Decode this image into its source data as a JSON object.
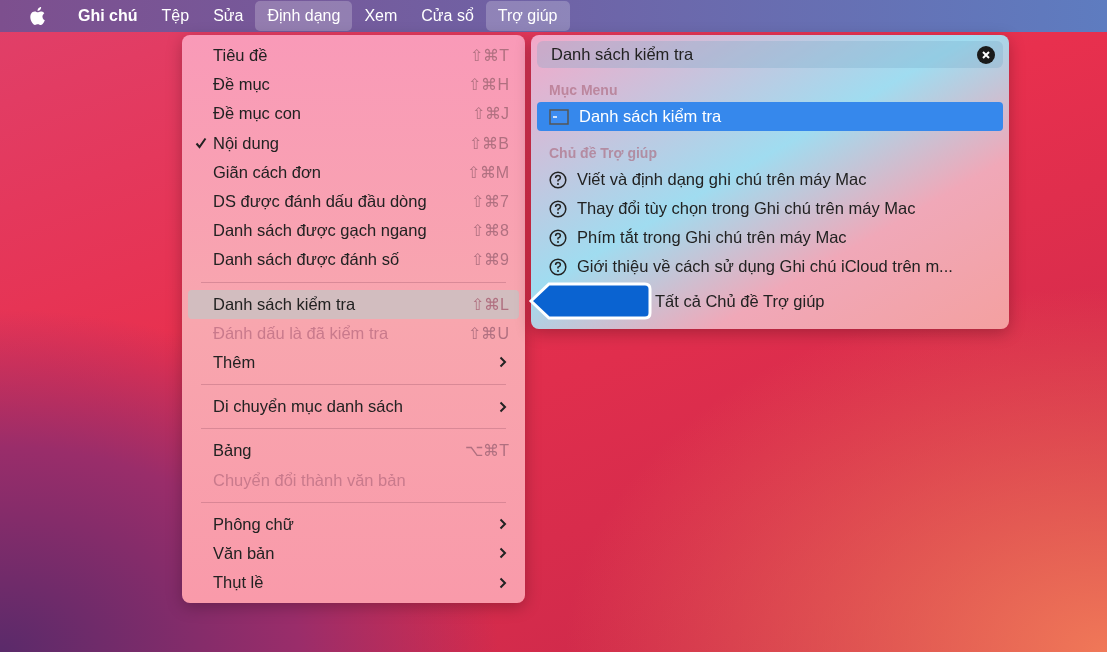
{
  "menu_bar": {
    "items": [
      {
        "label": "Ghi chú",
        "kind": "app",
        "selected": false
      },
      {
        "label": "Tệp",
        "kind": "menu",
        "selected": false
      },
      {
        "label": "Sửa",
        "kind": "menu",
        "selected": false
      },
      {
        "label": "Định dạng",
        "kind": "menu",
        "selected": true
      },
      {
        "label": "Xem",
        "kind": "menu",
        "selected": false
      },
      {
        "label": "Cửa sổ",
        "kind": "menu",
        "selected": false
      },
      {
        "label": "Trợ giúp",
        "kind": "menu",
        "selected": true
      }
    ]
  },
  "format_menu": {
    "items": [
      {
        "kind": "item",
        "label": "Tiêu đề",
        "shortcut": "⇧⌘T",
        "checked": false,
        "disabled": false,
        "selected": false,
        "submenu": false
      },
      {
        "kind": "item",
        "label": "Đề mục",
        "shortcut": "⇧⌘H",
        "checked": false,
        "disabled": false,
        "selected": false,
        "submenu": false
      },
      {
        "kind": "item",
        "label": "Đề mục con",
        "shortcut": "⇧⌘J",
        "checked": false,
        "disabled": false,
        "selected": false,
        "submenu": false
      },
      {
        "kind": "item",
        "label": "Nội dung",
        "shortcut": "⇧⌘B",
        "checked": true,
        "disabled": false,
        "selected": false,
        "submenu": false
      },
      {
        "kind": "item",
        "label": "Giãn cách đơn",
        "shortcut": "⇧⌘M",
        "checked": false,
        "disabled": false,
        "selected": false,
        "submenu": false
      },
      {
        "kind": "item",
        "label": "DS được đánh dấu đầu dòng",
        "shortcut": "⇧⌘7",
        "checked": false,
        "disabled": false,
        "selected": false,
        "submenu": false
      },
      {
        "kind": "item",
        "label": "Danh sách được gạch ngang",
        "shortcut": "⇧⌘8",
        "checked": false,
        "disabled": false,
        "selected": false,
        "submenu": false
      },
      {
        "kind": "item",
        "label": "Danh sách được đánh số",
        "shortcut": "⇧⌘9",
        "checked": false,
        "disabled": false,
        "selected": false,
        "submenu": false
      },
      {
        "kind": "separator"
      },
      {
        "kind": "item",
        "label": "Danh sách kiểm tra",
        "shortcut": "⇧⌘L",
        "checked": false,
        "disabled": false,
        "selected": true,
        "submenu": false
      },
      {
        "kind": "item",
        "label": "Đánh dấu là đã kiểm tra",
        "shortcut": "⇧⌘U",
        "checked": false,
        "disabled": true,
        "selected": false,
        "submenu": false
      },
      {
        "kind": "item",
        "label": "Thêm",
        "checked": false,
        "disabled": false,
        "selected": false,
        "submenu": true
      },
      {
        "kind": "separator"
      },
      {
        "kind": "item",
        "label": "Di chuyển mục danh sách",
        "checked": false,
        "disabled": false,
        "selected": false,
        "submenu": true
      },
      {
        "kind": "separator"
      },
      {
        "kind": "item",
        "label": "Bảng",
        "shortcut": "⌥⌘T",
        "checked": false,
        "disabled": false,
        "selected": false,
        "submenu": false
      },
      {
        "kind": "item",
        "label": "Chuyển đổi thành văn bản",
        "checked": false,
        "disabled": true,
        "selected": false,
        "submenu": false
      },
      {
        "kind": "separator"
      },
      {
        "kind": "item",
        "label": "Phông chữ",
        "checked": false,
        "disabled": false,
        "selected": false,
        "submenu": true
      },
      {
        "kind": "item",
        "label": "Văn bản",
        "checked": false,
        "disabled": false,
        "selected": false,
        "submenu": true
      },
      {
        "kind": "item",
        "label": "Thụt lề",
        "checked": false,
        "disabled": false,
        "selected": false,
        "submenu": true
      }
    ]
  },
  "help_menu": {
    "search": {
      "value": "Danh sách kiểm tra"
    },
    "sections": [
      {
        "title": "Mục Menu",
        "items": [
          {
            "kind": "menu-item",
            "label": "Danh sách kiểm tra",
            "selected": true
          }
        ]
      },
      {
        "title": "Chủ đề Trợ giúp",
        "items": [
          {
            "kind": "topic",
            "label": "Viết và định dạng ghi chú trên máy Mac",
            "selected": false
          },
          {
            "kind": "topic",
            "label": "Thay đổi tùy chọn trong Ghi chú trên máy Mac",
            "selected": false
          },
          {
            "kind": "topic",
            "label": "Phím tắt trong Ghi chú trên máy Mac",
            "selected": false
          },
          {
            "kind": "topic",
            "label": "Giới thiệu về cách sử dụng Ghi chú iCloud trên m...",
            "selected": false
          },
          {
            "kind": "all",
            "label": "Tất cả Chủ đề Trợ giúp",
            "selected": false
          }
        ]
      }
    ]
  }
}
